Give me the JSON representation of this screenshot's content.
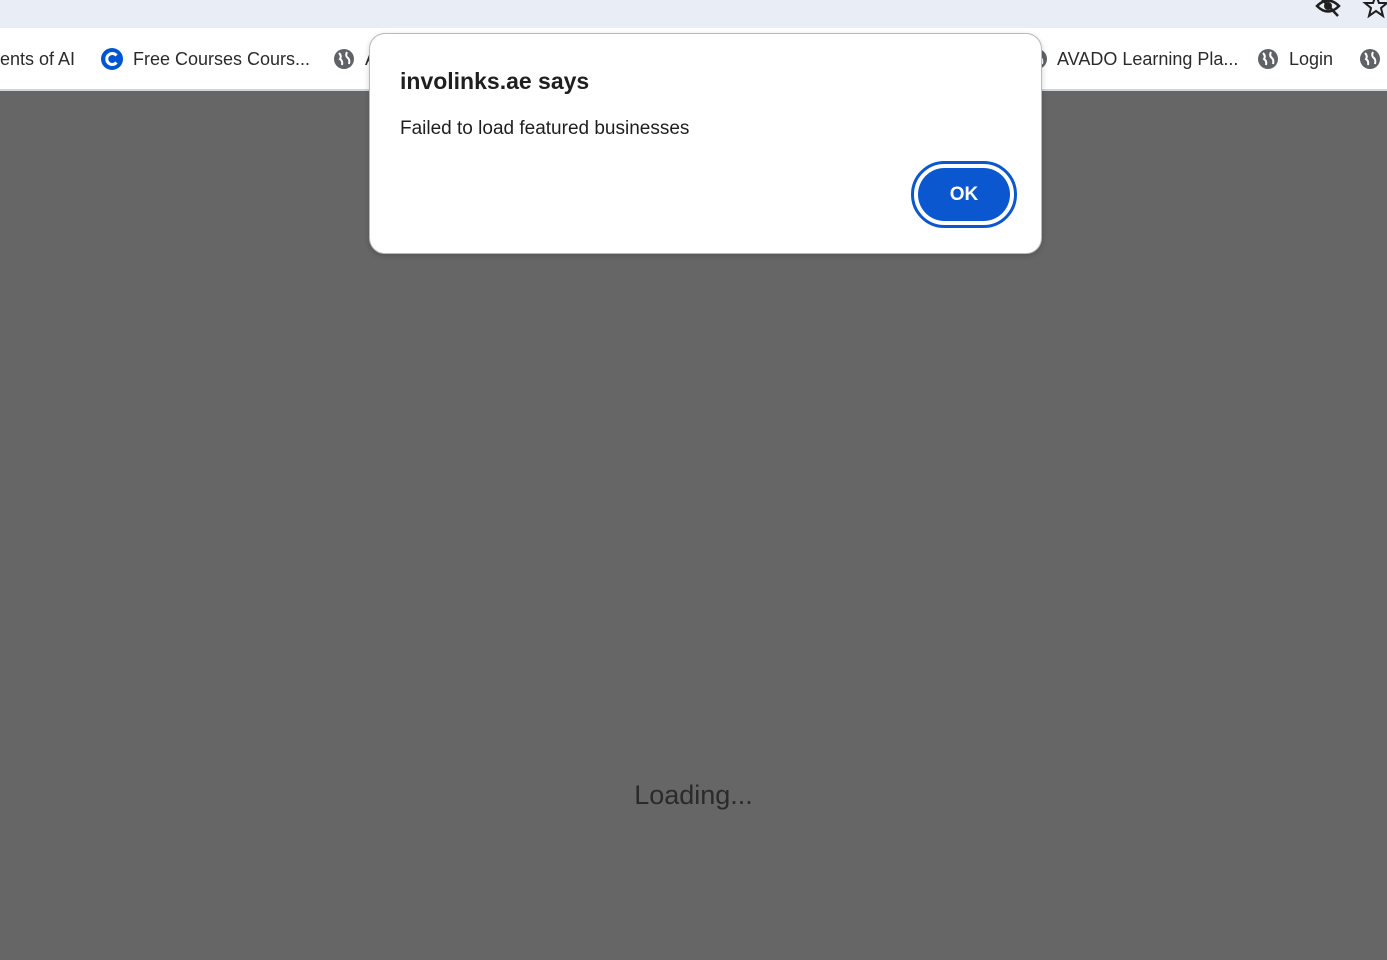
{
  "browser": {
    "toolbar_icons": [
      "eye-slash-icon",
      "star-icon"
    ],
    "bookmarks": [
      {
        "label": "ents of AI",
        "icon": "none"
      },
      {
        "label": "Free Courses Cours...",
        "icon": "coursera-c-icon"
      },
      {
        "label": "A",
        "icon": "globe-icon"
      },
      {
        "label": "AVADO Learning Pla...",
        "icon": "globe-icon"
      },
      {
        "label": "Login",
        "icon": "globe-icon"
      },
      {
        "label": "",
        "icon": "globe-icon"
      }
    ]
  },
  "page": {
    "loading_text": "Loading..."
  },
  "dialog": {
    "title": "involinks.ae says",
    "message": "Failed to load featured businesses",
    "ok_label": "OK"
  },
  "colors": {
    "overlay": "#666666",
    "accent": "#0b57d0",
    "toolbar": "#e9eef6"
  }
}
